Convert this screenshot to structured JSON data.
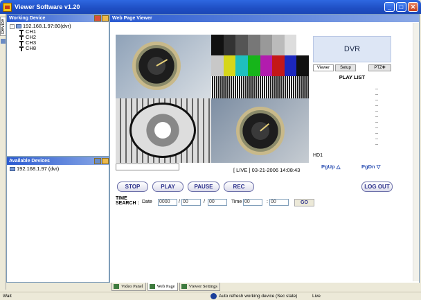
{
  "window": {
    "title": "Viewer Software v1.20"
  },
  "side_tab": {
    "label": "Device"
  },
  "working_devices": {
    "title": "Working Device",
    "root": "192.168.1.97:80(dvr)",
    "channels": [
      "CH1",
      "CH2",
      "CH3",
      "CH8"
    ]
  },
  "available_devices": {
    "title": "Available Devices",
    "items": [
      "192.168.1.97 (dvr)"
    ]
  },
  "web_viewer": {
    "title": "Web Page Viewer",
    "live_status": "[ LIVE ] 03-21-2006 14:08:43",
    "buttons": {
      "stop": "STOP",
      "play": "PLAY",
      "pause": "PAUSE",
      "rec": "REC",
      "logout": "LOG OUT",
      "go": "GO"
    },
    "time_search": {
      "label_line1": "TIME",
      "label_line2": "SEARCH :",
      "date_label": "Date",
      "year": "0000",
      "month": "00",
      "day": "00",
      "time_label": "Time",
      "hour": "00",
      "minute": "00",
      "sep_slash": "/",
      "sep_colon": ":"
    },
    "dvr": {
      "label": "DVR",
      "tabs": [
        "Viewer",
        "Setup",
        "PTZ"
      ],
      "playlist": "PLAY LIST",
      "hd": "HD1",
      "pgup": "PgUp",
      "pgdn": "PgDn"
    }
  },
  "bottom_tabs": [
    "Video Panel",
    "Web Page",
    "Viewer Settings"
  ],
  "status_bar": {
    "left": "Wait",
    "message": "Auto refresh working device (Sec state)",
    "live": "Live"
  },
  "colors": {
    "accent": "#2a5ad1",
    "button_text": "#2b2f8a"
  }
}
